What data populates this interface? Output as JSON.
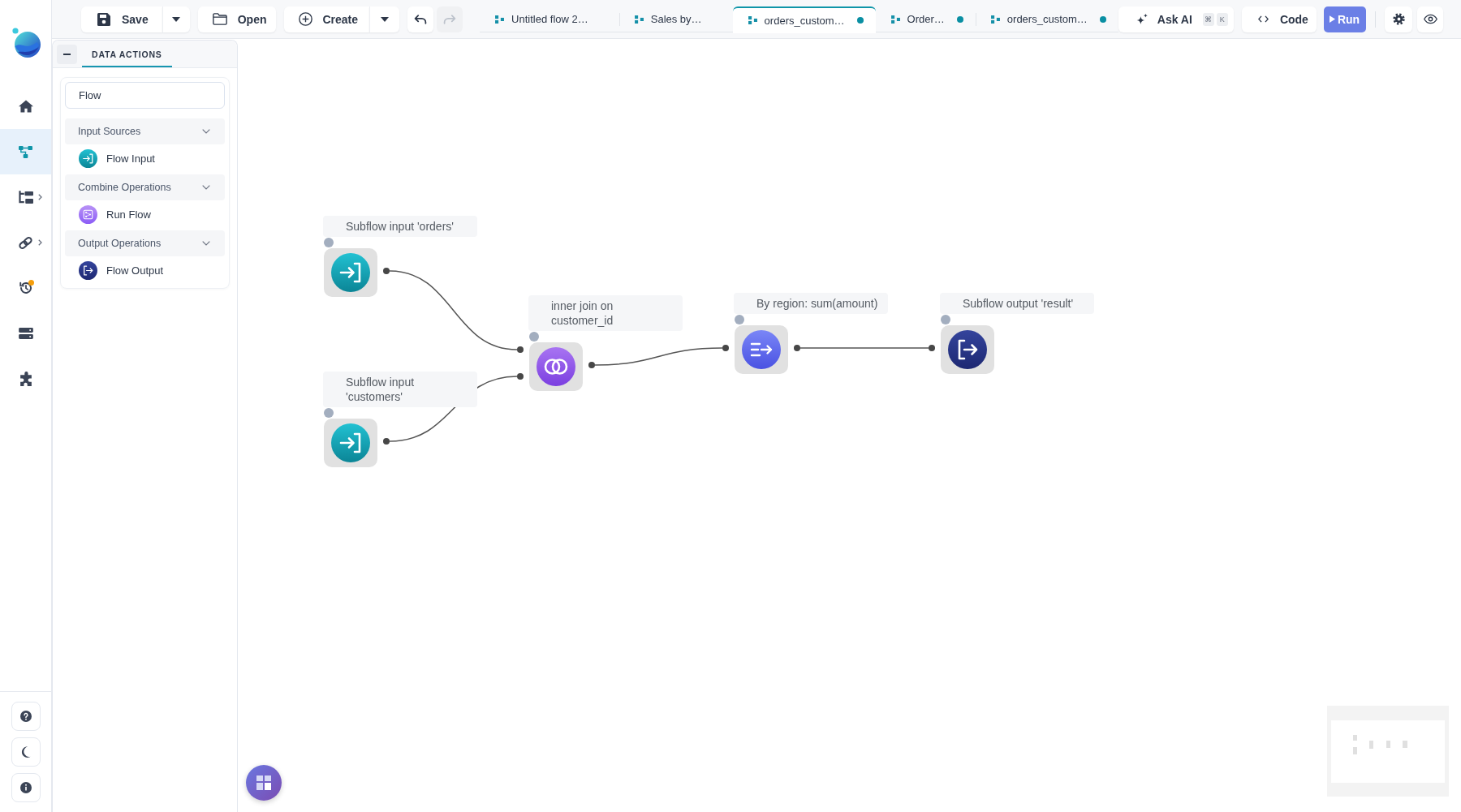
{
  "rail": {
    "items": [
      {
        "kind": "home",
        "selected": false,
        "expandable": false,
        "notification": false
      },
      {
        "kind": "flow",
        "selected": true,
        "expandable": false,
        "notification": false
      },
      {
        "kind": "folders",
        "selected": false,
        "expandable": true,
        "notification": false
      },
      {
        "kind": "link",
        "selected": false,
        "expandable": true,
        "notification": false
      },
      {
        "kind": "history",
        "selected": false,
        "expandable": false,
        "notification": true
      },
      {
        "kind": "storage",
        "selected": false,
        "expandable": false,
        "notification": false
      },
      {
        "kind": "extensions",
        "selected": false,
        "expandable": false,
        "notification": false
      }
    ],
    "footer": [
      {
        "kind": "help"
      },
      {
        "kind": "theme"
      },
      {
        "kind": "info"
      }
    ]
  },
  "toolbar": {
    "save": {
      "label": "Save"
    },
    "open": {
      "label": "Open"
    },
    "create": {
      "label": "Create"
    },
    "undo": {
      "disabled": false
    },
    "redo": {
      "disabled": true
    }
  },
  "tabs": [
    {
      "label": "Untitled flow 2…",
      "selected": false,
      "unsaved": false
    },
    {
      "label": "Sales by…",
      "selected": false,
      "unsaved": false
    },
    {
      "label": "orders_custom…",
      "selected": true,
      "unsaved": true
    },
    {
      "label": "Order…",
      "selected": false,
      "unsaved": true
    },
    {
      "label": "orders_custom…",
      "selected": false,
      "unsaved": true
    }
  ],
  "actions": {
    "ask_ai": {
      "label": "Ask AI",
      "shortcut": [
        "⌘",
        "K"
      ]
    },
    "code": {
      "label": "Code"
    },
    "run": {
      "label": "Run"
    }
  },
  "panel": {
    "tab": {
      "label": "DATA ACTIONS",
      "selected": true
    },
    "search": {
      "value": "Flow"
    },
    "groups": [
      {
        "title": "Input Sources",
        "expanded": true,
        "items": [
          {
            "label": "Flow Input",
            "kind": "input"
          }
        ]
      },
      {
        "title": "Combine Operations",
        "expanded": true,
        "items": [
          {
            "label": "Run Flow",
            "kind": "subflow"
          }
        ]
      },
      {
        "title": "Output Operations",
        "expanded": true,
        "items": [
          {
            "label": "Flow Output",
            "kind": "output"
          }
        ]
      }
    ]
  },
  "canvas": {
    "nodes": [
      {
        "label": "Subflow input 'orders'",
        "kind": "input"
      },
      {
        "label": "Subflow input 'customers'",
        "kind": "input"
      },
      {
        "label": "inner join on customer_id",
        "kind": "join"
      },
      {
        "label": "By region: sum(amount)",
        "kind": "aggregate"
      },
      {
        "label": "Subflow output 'result'",
        "kind": "output"
      }
    ]
  }
}
